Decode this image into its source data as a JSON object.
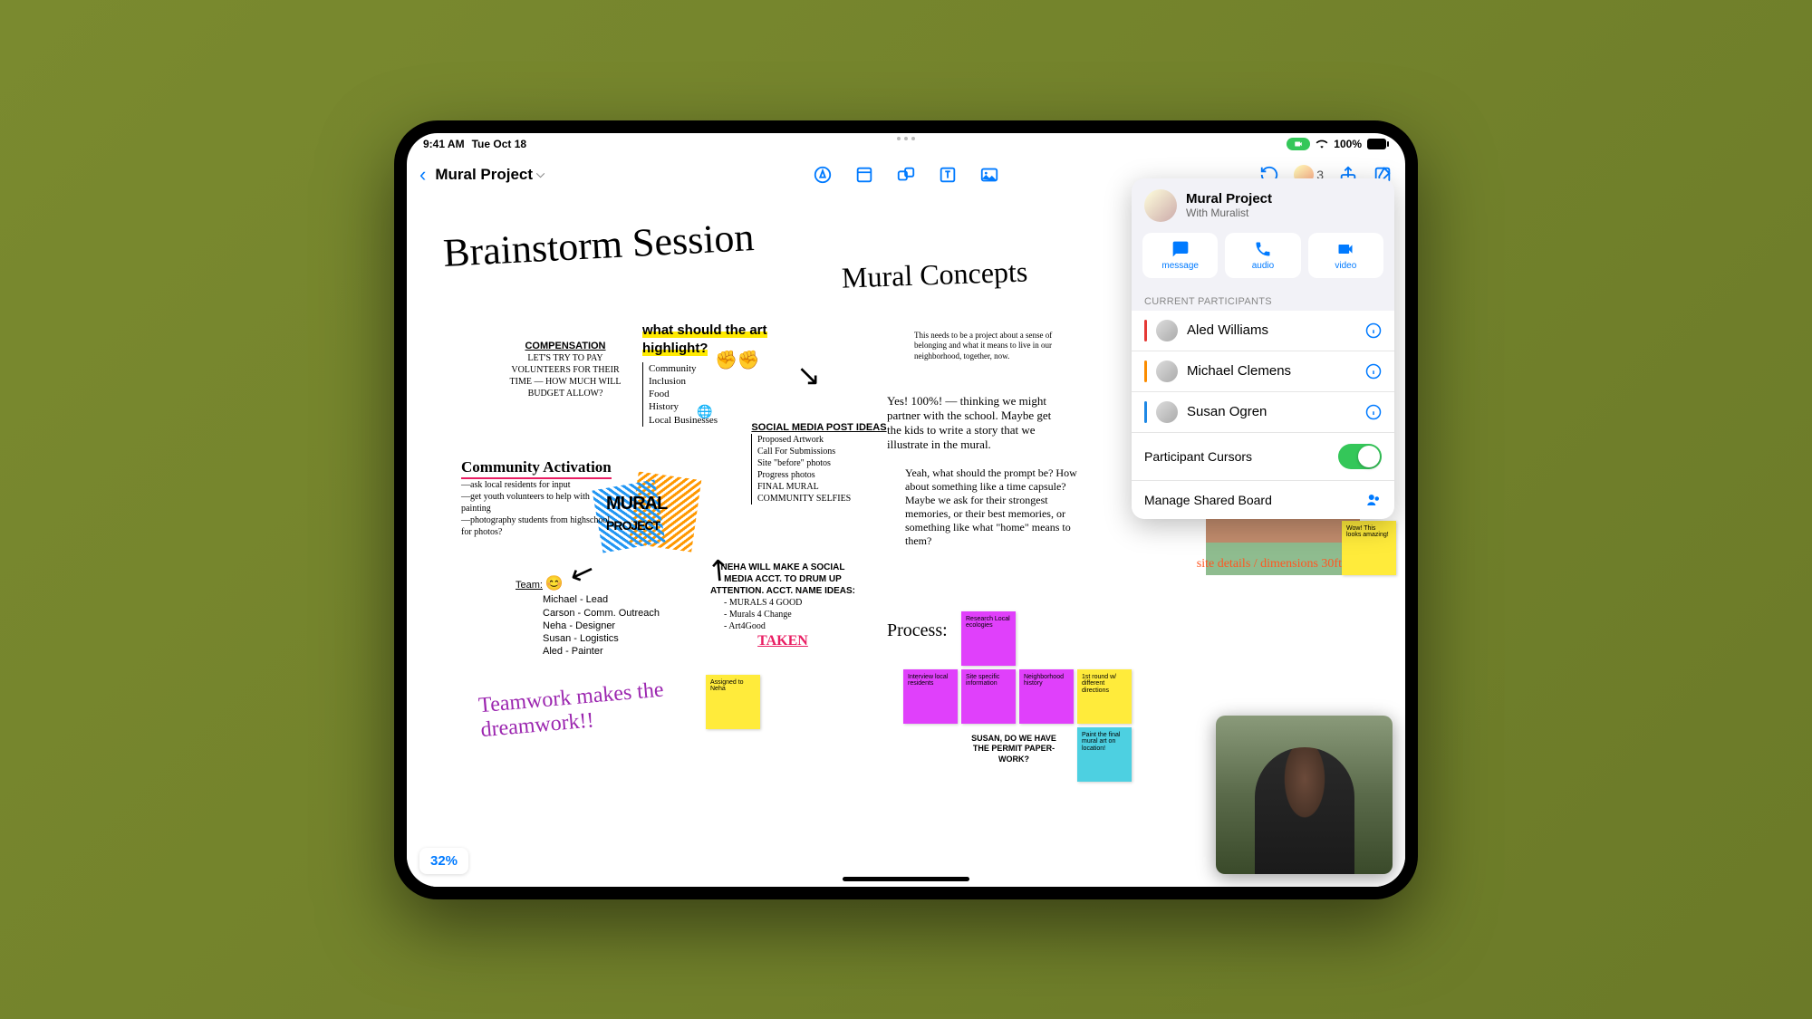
{
  "status": {
    "time": "9:41 AM",
    "date": "Tue Oct 18",
    "battery": "100%"
  },
  "toolbar": {
    "board_name": "Mural Project",
    "collaborator_count": "3"
  },
  "zoom": "32%",
  "canvas": {
    "title1": "Brainstorm Session",
    "title2": "Mural Concepts",
    "compensation_hdr": "COMPENSATION",
    "compensation": "LET'S TRY TO PAY VOLUNTEERS FOR THEIR TIME — HOW MUCH WILL BUDGET ALLOW?",
    "highlight_q": "what should the art highlight?",
    "highlight_items": "Community\nInclusion\nFood\nHistory\nLocal Businesses",
    "community_hdr": "Community Activation",
    "community": "—ask local residents for input\n—get youth volunteers to help with painting\n—photography students from highschool for photos?",
    "social_hdr": "SOCIAL MEDIA POST IDEAS",
    "social": "Proposed Artwork\nCall For Submissions\nSite \"before\" photos\nProgress photos\nFINAL MURAL\nCOMMUNITY SELFIES",
    "team_hdr": "Team:",
    "team": "Michael - Lead\nCarson - Comm. Outreach\nNeha - Designer\nSusan - Logistics\nAled - Painter",
    "neha_hdr": "NEHA WILL MAKE A SOCIAL MEDIA ACCT. TO DRUM UP ATTENTION. ACCT. NAME IDEAS:",
    "neha_ideas": "- MURALS 4 GOOD\n- Murals 4 Change\n- Art4Good",
    "taken": "TAKEN",
    "teamwork": "Teamwork makes the dreamwork!!",
    "mural_word": "MURAL",
    "project_word": "PROJECT",
    "desc": "This needs to be a project about a sense of belonging and what it means to live in our neighborhood, together, now.",
    "yes100": "Yes! 100%! — thinking we might partner with the school. Maybe get the kids to write a story that we illustrate in the mural.",
    "yeah": "Yeah, what should the prompt be? How about something like a time capsule? Maybe we ask for their strongest memories, or their best memories, or something like what \"home\" means to them?",
    "site": "site details / dimensions 30ft",
    "process": "Process:",
    "susan": "SUSAN, DO WE HAVE THE PERMIT PAPER-WORK?"
  },
  "stickies": {
    "assigned": "Assigned to Neha",
    "wow": "Wow! This looks amazing!",
    "research": "Research Local ecologies",
    "interview": "Interview local residents",
    "sitespec": "Site specific information",
    "neighborhood": "Neighborhood history",
    "round1": "1st round w/ different directions",
    "paint": "Paint the final mural art on location!"
  },
  "panel": {
    "title": "Mural Project",
    "subtitle": "With Muralist",
    "actions": {
      "message": "message",
      "audio": "audio",
      "video": "video"
    },
    "section": "CURRENT PARTICIPANTS",
    "participants": [
      {
        "name": "Aled Williams",
        "color": "#e53935"
      },
      {
        "name": "Michael Clemens",
        "color": "#fb8c00"
      },
      {
        "name": "Susan Ogren",
        "color": "#1e88e5"
      }
    ],
    "cursors": "Participant Cursors",
    "manage": "Manage Shared Board"
  }
}
